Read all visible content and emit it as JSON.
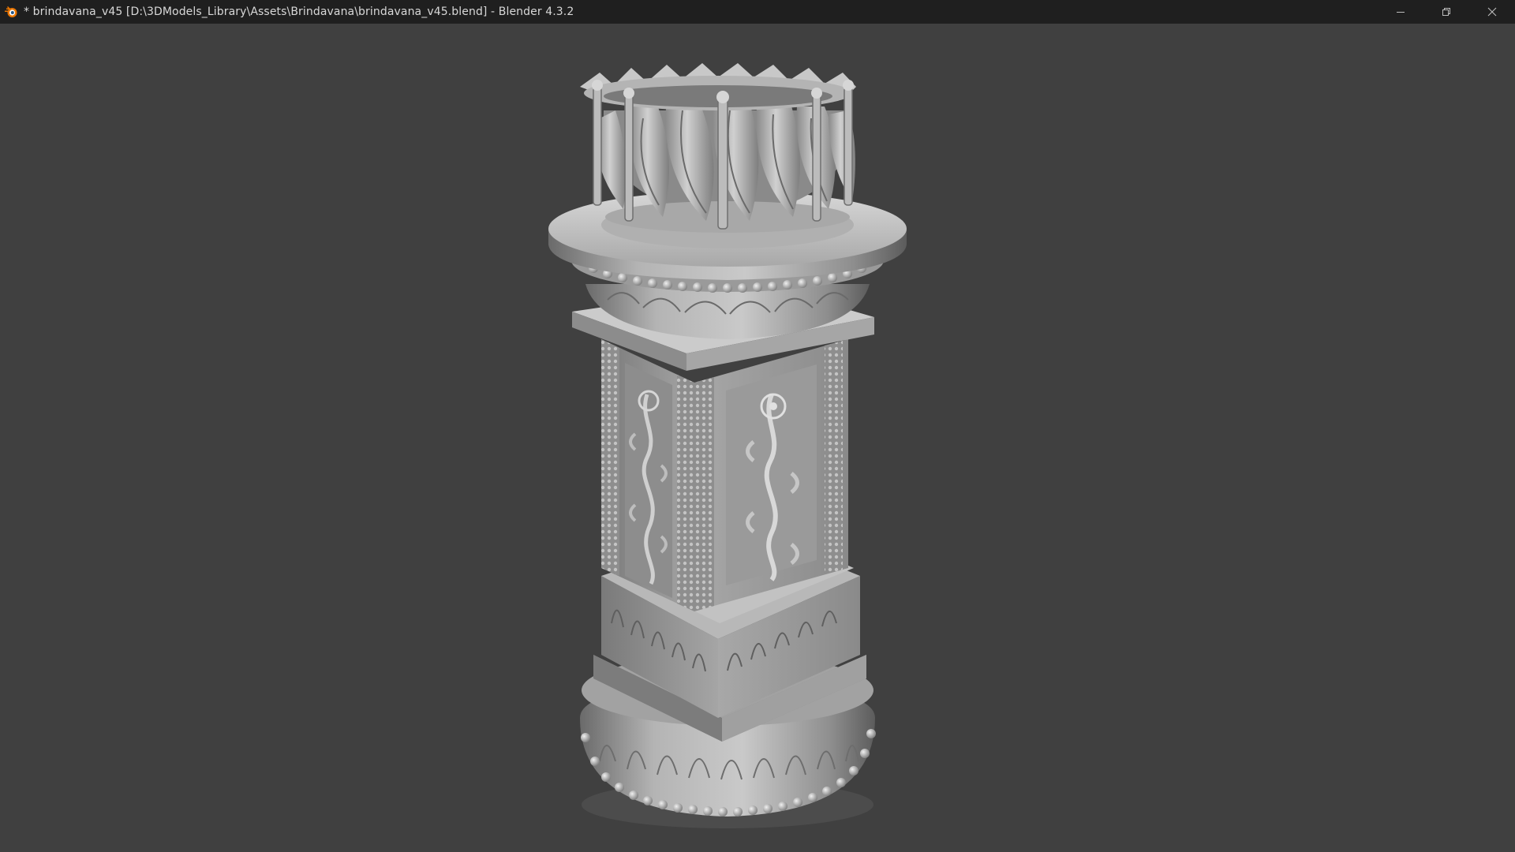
{
  "window": {
    "title": "* brindavana_v45 [D:\\3DModels_Library\\Assets\\Brindavana\\brindavana_v45.blend] - Blender 4.3.2",
    "app_icon": "blender-logo-icon",
    "controls": {
      "minimize_icon": "minimize-icon",
      "restore_icon": "restore-icon",
      "close_icon": "close-icon"
    }
  },
  "colors": {
    "titlebar": "#1f1f1f",
    "viewport_background": "#404040",
    "model_base": "#9c9c9c",
    "model_highlight": "#d2d2d2",
    "model_shadow": "#5e5e5e",
    "blender_orange": "#ea7600"
  },
  "viewport": {
    "object": "brindavana-model"
  }
}
